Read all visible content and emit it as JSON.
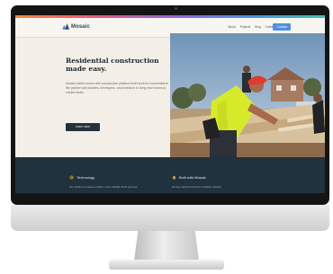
{
  "site": {
    "logo_text": "Mosaic",
    "nav": {
      "links": [
        "About",
        "Projects",
        "Blog",
        "Careers"
      ],
      "cta": "Contact"
    },
    "hero": {
      "title": "Residential construction made easy.",
      "body": "Mosaic builds homes with a production platform that's built for homebuilders. We partner with builders, developers, and investors to bring new homes to market faster.",
      "button": "Learn more"
    },
    "features": [
      {
        "icon": "gear-icon",
        "title": "Technology",
        "text": "Our platform powers a faster, more reliable build process"
      },
      {
        "icon": "house-icon",
        "title": "Built with Mosaic",
        "text": "Homes delivered across multiple markets"
      }
    ]
  },
  "colors": {
    "accent": "#4d8fe0",
    "navy": "#20323d",
    "cream": "#f3efe6"
  }
}
